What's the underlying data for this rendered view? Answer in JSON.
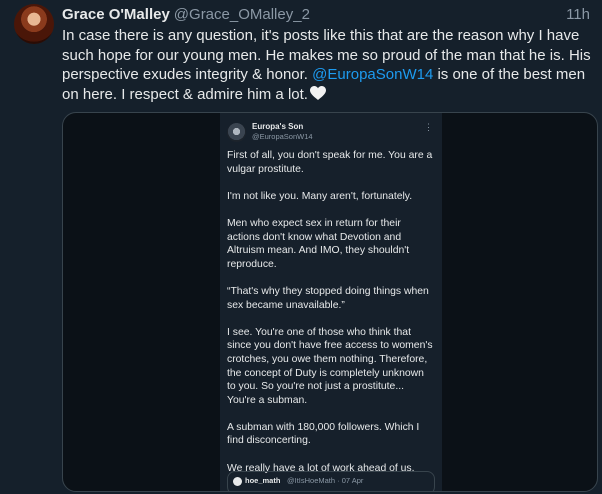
{
  "tweet": {
    "display_name": "Grace O'Malley",
    "handle": "@Grace_OMalley_2",
    "time": "11h",
    "text_part1": "In case there is any question, it's posts like this that are the reason why I have such hope for our young men. He makes me so proud of the man that he is. His perspective exudes integrity & honor. ",
    "mention": "@EuropaSonW14",
    "text_part2": " is one of the best men on here. I respect & admire him a lot."
  },
  "embedded": {
    "name": "Europa's Son",
    "handle": "@EuropaSonW14",
    "more": "⋮",
    "paragraphs": [
      "First of all, you don't speak for me. You are a vulgar prostitute.",
      "I'm not like you. Many aren't, fortunately.",
      "Men who expect sex in return for their actions don't know what Devotion and Altruism mean. And IMO, they shouldn't reproduce.",
      "“That's why they stopped doing things when sex became unavailable.”",
      "I see. You're one of those who think that since you don't have free access to women's crotches, you owe them nothing. Therefore, the concept of Duty is completely unknown to you. So you're not just a prostitute... You're a subman.",
      "A subman with 180,000 followers. Which I find disconcerting.",
      "We really have a lot of work ahead of us."
    ],
    "quote": {
      "name": "hoe_math",
      "meta": "@ItIsHoeMath · 07 Apr"
    }
  },
  "colors": {
    "background": "#15202b",
    "accent": "#1d9bf0",
    "text": "#e7e9ea",
    "muted": "#8b98a5",
    "border": "#38444d"
  }
}
